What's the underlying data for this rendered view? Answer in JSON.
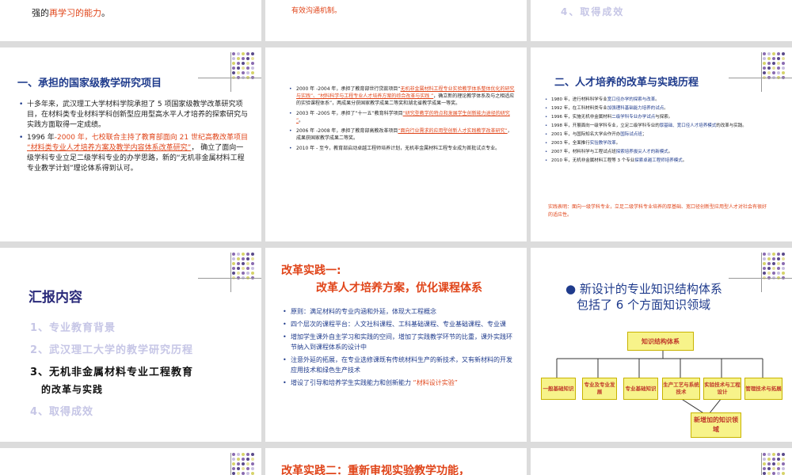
{
  "row1": {
    "slide1_text_prefix": "强的",
    "slide1_text_red": "再学习的能力",
    "slide1_text_suffix": "。",
    "slide2_text": "有效沟通机制。",
    "slide3_item": "4、取得成效"
  },
  "slide_a": {
    "title": "一、承担的国家级教学研究项目",
    "p1": "十多年来，武汉理工大学材料学院承担了 5 项国家级教学改革研究项目，在材料类专业材料学科创新型应用型高水平人才培养的探索研究与实践方面取得一定成绩。",
    "p2_a": "1996 年",
    "p2_b": "-2000 年，七校联合主持了教育部面向 21 世纪高教改革项目 ",
    "p2_c": "“材料类专业人才培养方案及教学内容体系改革研究”",
    "p2_d": "， 确立了面向一级学科专业立足二级学科专业的办学思路，新的“无机非金属材料工程专业教学计划”理论体系得到认可。"
  },
  "slide_b": {
    "p1_a": "2000 年 -2004 年，承担了教育部世行贷款项目“",
    "p1_b": "无机非金属材料工程专业实验教学体系整体优化的研究与实践”、“材料科学与工程专业人才培养方案的综合改革与实践 ”",
    "p1_c": "，确立新的理论教学体系及与之相适应的实验课程体系”，两成果分获国家教学成果二等奖和湖北省教学成果一等奖。",
    "p2_a": "2003 年 -2005 年，承担了“十一五”教育科学项目",
    "p2_b": "“研究型教学的特点和发展学生创新能力途径的研究 ”",
    "p2_c": "。",
    "p3_a": "2006 年 -2008 年，承担了教育部高教改革项目",
    "p3_b": "“面向行业需求的应用型创新人才实践教学改革研究”",
    "p3_c": "，成果获国家教学成果二等奖。",
    "p4": "2010 年 - 至今，教育部启动卓越工程师培养计划，无机非金属材料工程专业成为首批试点专业。"
  },
  "slide_c": {
    "title": "二、人才培养的改革与实践历程",
    "items": [
      {
        "a": "1980 年，进行材料科学专业",
        "b": "宽口径办学的探索与改革",
        "c": "。"
      },
      {
        "a": "1992 年，在工科材料类专业",
        "b": "加强理科基础能力培养的试点",
        "c": "。"
      },
      {
        "a": "1996 年，实施无机非金属材料",
        "b": "二级学科专业办学试点",
        "c": "与探索。"
      },
      {
        "a": "1998 年，开展面向一级学科专业，立足二级学科专业的",
        "b": "厚基础、宽口径人才培养模式",
        "c": "的改革与实践。"
      },
      {
        "a": "2001 年，与国际知名大学合作开办",
        "b": "国际试点班",
        "c": "；"
      },
      {
        "a": "2003 年，全面推行",
        "b": "实验教学改革",
        "c": "。"
      },
      {
        "a": "2007 年，材料科学与工程试点班",
        "b": "探索培养拔尖人才的新模式",
        "c": "。"
      },
      {
        "a": "2010 年，无机非金属材料工程等 3 个专业",
        "b": "探索卓越工程师培养模式",
        "c": "。"
      }
    ],
    "conclusion": "实践表明：面向一级学科专业，立足二级学科专业培养的厚基础、宽口径创新型应用型人才对社会有很好的适应性。"
  },
  "slide_d": {
    "title": "汇报内容",
    "items": [
      "1、专业教育背景",
      "2、武汉理工大学的教学研究历程",
      "3、无机非金属材料专业工程教育",
      "的改革与实践",
      "4、取得成效"
    ]
  },
  "slide_e": {
    "title1": "改革实践一:",
    "title2": "改革人才培养方案，优化课程体系",
    "items": [
      "原则：满足材料的专业内涵和外延，体现大工程概念",
      "四个层次的课程平台：人文社科课程、工科基础课程、专业基础课程、专业课",
      "增加学生课外自主学习和实践的空间，增加了实践教学环节的比重，课外实践环节纳入到课程体系的设计中",
      "注意外延的拓展，在专业选修课既有传统材料生产的新技术，又有新材料的开发应用技术和绿色生产技术"
    ],
    "item5_a": "增设了引导和培养学生实践能力和创新能力 ",
    "item5_b": "“材料设计实验”"
  },
  "slide_f": {
    "title1": "新设计的专业知识结构体系",
    "title2": "包括了 6  个方面知识领域",
    "root": "知识结构体系",
    "leaves": [
      "一般基础知识",
      "专业及专业发展",
      "专业基础知识",
      "生产工艺与系统技术",
      "实验技术与工程设计",
      "管理技术与拓展"
    ],
    "new": "新增加的知识领域"
  },
  "row4": {
    "slide_h_title": "改革实践二：重新审视实验教学功能，"
  },
  "colors": {
    "accent_blue": "#1f3b8c",
    "accent_red": "#e0451a",
    "box_yellow": "#f7f38a"
  }
}
